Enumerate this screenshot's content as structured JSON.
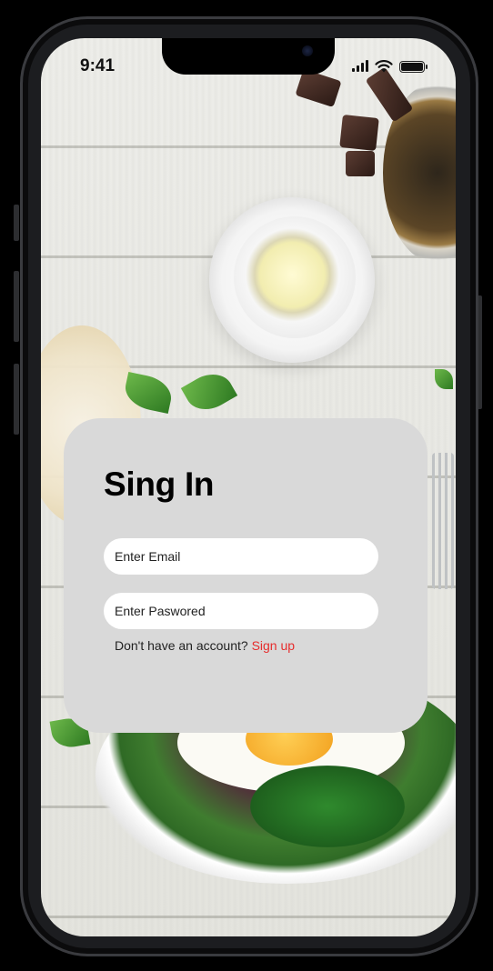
{
  "status_bar": {
    "time": "9:41",
    "icons": [
      "cellular-signal-icon",
      "wifi-icon",
      "battery-icon"
    ]
  },
  "signin": {
    "title": "Sing In",
    "email_placeholder": "Enter Email",
    "password_placeholder": "Enter Paswored",
    "prompt_text": "Don't have an account?",
    "signup_label": "Sign up"
  },
  "colors": {
    "card_background": "#d9d9d9",
    "link": "#e62d2d",
    "field_background": "#ffffff"
  }
}
